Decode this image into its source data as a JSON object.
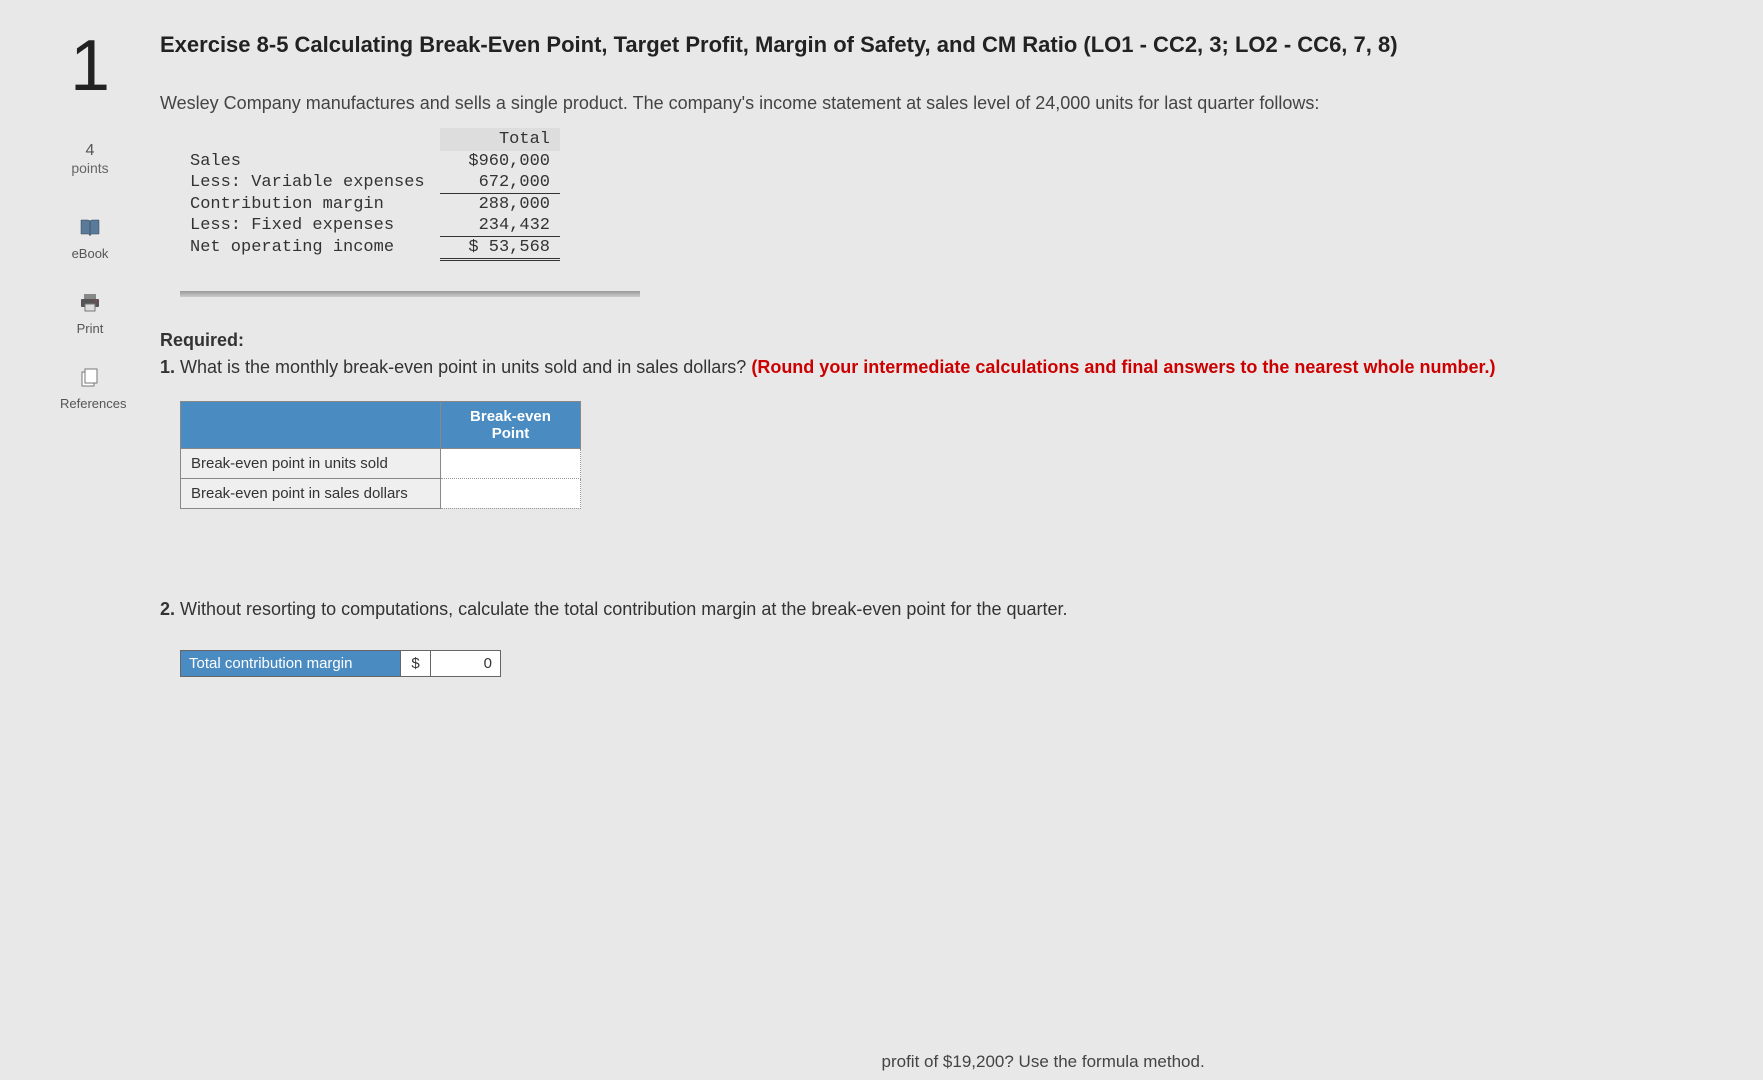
{
  "question": {
    "number": "1",
    "points_value": "4",
    "points_label": "points"
  },
  "sidebar": {
    "ebook": "eBook",
    "print": "Print",
    "references": "References"
  },
  "title": "Exercise 8-5 Calculating Break-Even Point, Target Profit, Margin of Safety, and CM Ratio (LO1 - CC2, 3; LO2 - CC6, 7, 8)",
  "intro": "Wesley Company manufactures and sells a single product. The company's income statement at sales level of 24,000 units for last quarter follows:",
  "income_statement": {
    "header": "Total",
    "rows": [
      {
        "label": "Sales",
        "value": "$960,000"
      },
      {
        "label": "Less: Variable expenses",
        "value": "672,000"
      },
      {
        "label": "Contribution margin",
        "value": "288,000"
      },
      {
        "label": "Less: Fixed expenses",
        "value": "234,432"
      },
      {
        "label": "Net operating income",
        "value": "$ 53,568"
      }
    ]
  },
  "required": {
    "heading": "Required:",
    "q1_lead": "1. ",
    "q1_text": "What is the monthly break-even point in units sold and in sales dollars? ",
    "q1_hint": "(Round your intermediate calculations and final answers to the nearest whole number.)"
  },
  "answer_table": {
    "header": "Break-even Point",
    "rows": [
      "Break-even point in units sold",
      "Break-even point in sales dollars"
    ]
  },
  "q2": {
    "lead": "2. ",
    "text": "Without resorting to computations, calculate the total contribution margin at the break-even point for the quarter."
  },
  "cm_box": {
    "label": "Total contribution margin",
    "currency": "$",
    "value": "0"
  },
  "footer_cut": "profit of $19,200? Use the formula method."
}
